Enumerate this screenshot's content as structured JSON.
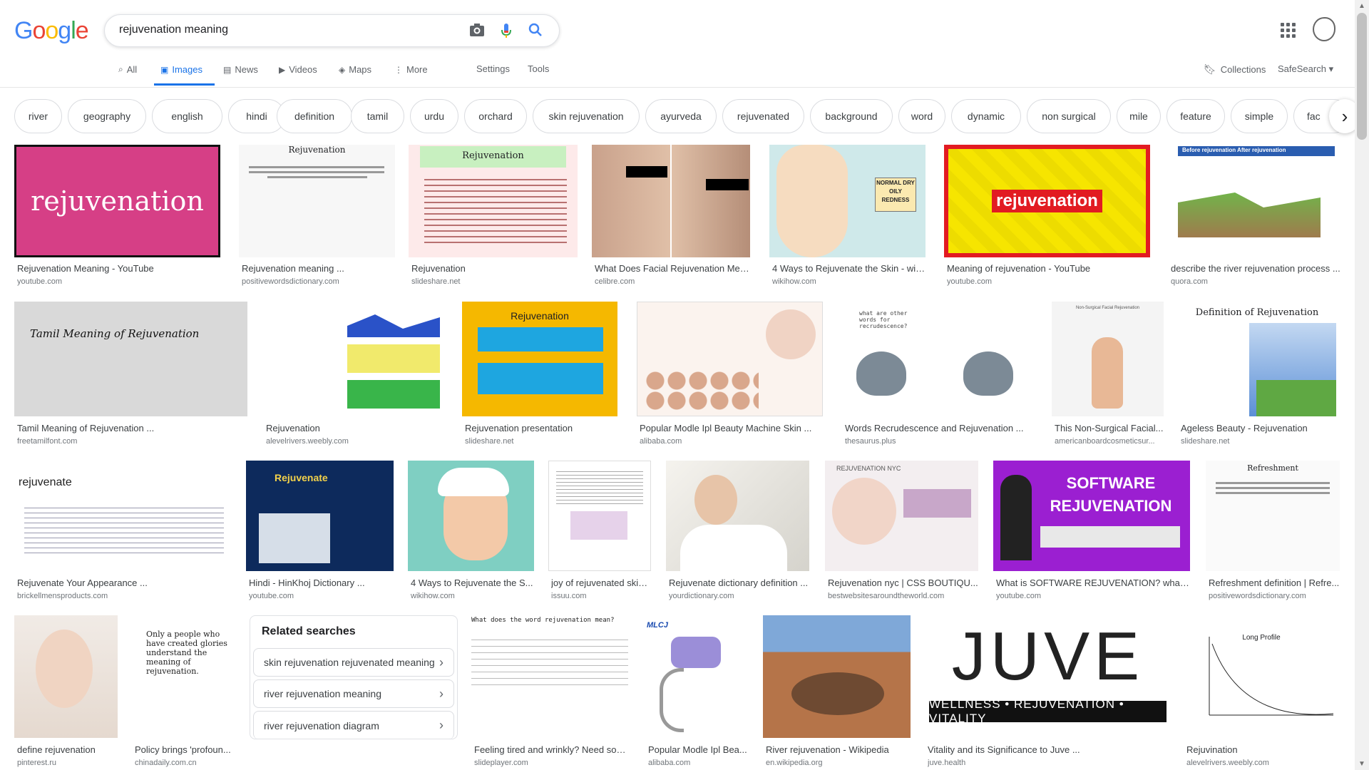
{
  "header": {
    "logo_letters": [
      "G",
      "o",
      "o",
      "g",
      "l",
      "e"
    ],
    "search_value": "rejuvenation meaning",
    "icons": [
      "camera-icon",
      "mic-icon",
      "search-icon",
      "apps-grid-icon",
      "account-avatar"
    ]
  },
  "tabs": [
    {
      "label": "All",
      "icon": "search-icon"
    },
    {
      "label": "Images",
      "icon": "image-icon",
      "active": true
    },
    {
      "label": "News",
      "icon": "news-icon"
    },
    {
      "label": "Videos",
      "icon": "video-icon"
    },
    {
      "label": "Maps",
      "icon": "map-icon"
    },
    {
      "label": "More",
      "icon": "more-vert-icon"
    }
  ],
  "settings_label": "Settings",
  "tools_label": "Tools",
  "collections_label": "Collections",
  "safesearch_label": "SafeSearch",
  "chips": [
    "river",
    "geography",
    "english",
    "hindi",
    "definition",
    "tamil",
    "urdu",
    "orchard",
    "skin rejuvenation",
    "ayurveda",
    "rejuvenated",
    "background",
    "word",
    "dynamic",
    "non surgical",
    "mile",
    "feature",
    "simple",
    "fac"
  ],
  "results": [
    {
      "title": "Rejuvenation Meaning - YouTube",
      "source": "youtube.com",
      "thumb_text": "rejuvenation"
    },
    {
      "title": "Rejuvenation meaning ...",
      "source": "positivewordsdictionary.com",
      "thumb_text": "Rejuvenation"
    },
    {
      "title": "Rejuvenation",
      "source": "slideshare.net",
      "thumb_text": "Rejuvenation"
    },
    {
      "title": "What Does Facial Rejuvenation Mean?",
      "source": "celibre.com",
      "thumb_text": ""
    },
    {
      "title": "4 Ways to Rejuvenate the Skin - wiki...",
      "source": "wikihow.com",
      "thumb_text": "NORMAL DRY OILY REDNESS"
    },
    {
      "title": "Meaning of rejuvenation - YouTube",
      "source": "youtube.com",
      "thumb_text": "rejuvenation"
    },
    {
      "title": "describe the river rejuvenation process ...",
      "source": "quora.com",
      "thumb_text": "Before rejuvenation  After rejuvenation"
    },
    {
      "title": "Tamil Meaning of Rejuvenation ...",
      "source": "freetamilfont.com",
      "thumb_text": "Tamil Meaning of Rejuvenation"
    },
    {
      "title": "Rejuvenation",
      "source": "alevelrivers.weebly.com",
      "thumb_text": ""
    },
    {
      "title": "Rejuvenation presentation",
      "source": "slideshare.net",
      "thumb_text": "Rejuvenation"
    },
    {
      "title": "Popular Modle Ipl Beauty Machine Skin ...",
      "source": "alibaba.com",
      "thumb_text": ""
    },
    {
      "title": "Words Recrudescence and Rejuvenation ...",
      "source": "thesaurus.plus",
      "thumb_text": "what are other words for recrudescence?"
    },
    {
      "title": "This Non-Surgical Facial...",
      "source": "americanboardcosmeticsur...",
      "thumb_text": "Non-Surgical Facial Rejuvenation"
    },
    {
      "title": "Ageless Beauty - Rejuvenation",
      "source": "slideshare.net",
      "thumb_text": "Definition of Rejuvenation"
    },
    {
      "title": "Rejuvenate Your Appearance ...",
      "source": "brickellmensproducts.com",
      "thumb_text": "rejuvenate"
    },
    {
      "title": "Hindi - HinKhoj Dictionary ...",
      "source": "youtube.com",
      "thumb_text": "Rejuvenate"
    },
    {
      "title": "4 Ways to Rejuvenate the S...",
      "source": "wikihow.com",
      "thumb_text": ""
    },
    {
      "title": "joy of rejuvenated skin...",
      "source": "issuu.com",
      "thumb_text": ""
    },
    {
      "title": "Rejuvenate dictionary definition ...",
      "source": "yourdictionary.com",
      "thumb_text": ""
    },
    {
      "title": "Rejuvenation nyc | CSS BOUTIQU...",
      "source": "bestwebsitesaroundtheworld.com",
      "thumb_text": "REJUVENATION NYC"
    },
    {
      "title": "What is SOFTWARE REJUVENATION? what ...",
      "source": "youtube.com",
      "thumb_text": "SOFTWARE REJUVENATION"
    },
    {
      "title": "Refreshment definition | Refre...",
      "source": "positivewordsdictionary.com",
      "thumb_text": "Refreshment"
    },
    {
      "title": "define rejuvenation",
      "source": "pinterest.ru",
      "thumb_text": ""
    },
    {
      "title": "Policy brings 'profoun...",
      "source": "chinadaily.com.cn",
      "thumb_text": "Only a people who have created glories understand the meaning of rejuvenation."
    },
    {
      "title": "Feeling tired and wrinkly? Need som...",
      "source": "slideplayer.com",
      "thumb_text": "What does the word rejuvenation mean?"
    },
    {
      "title": "Popular Modle Ipl Bea...",
      "source": "alibaba.com",
      "thumb_text": "MLCJ"
    },
    {
      "title": "River rejuvenation - Wikipedia",
      "source": "en.wikipedia.org",
      "thumb_text": ""
    },
    {
      "title": "Vitality and its Significance to Juve ...",
      "source": "juve.health",
      "thumb_text": "JUVE"
    },
    {
      "title": "Rejuvination",
      "source": "alevelrivers.weebly.com",
      "thumb_text": "Long Profile"
    }
  ],
  "related": {
    "title": "Related searches",
    "items": [
      "skin rejuvenation rejuvenated meaning",
      "river rejuvenation meaning",
      "river rejuvenation diagram"
    ]
  }
}
